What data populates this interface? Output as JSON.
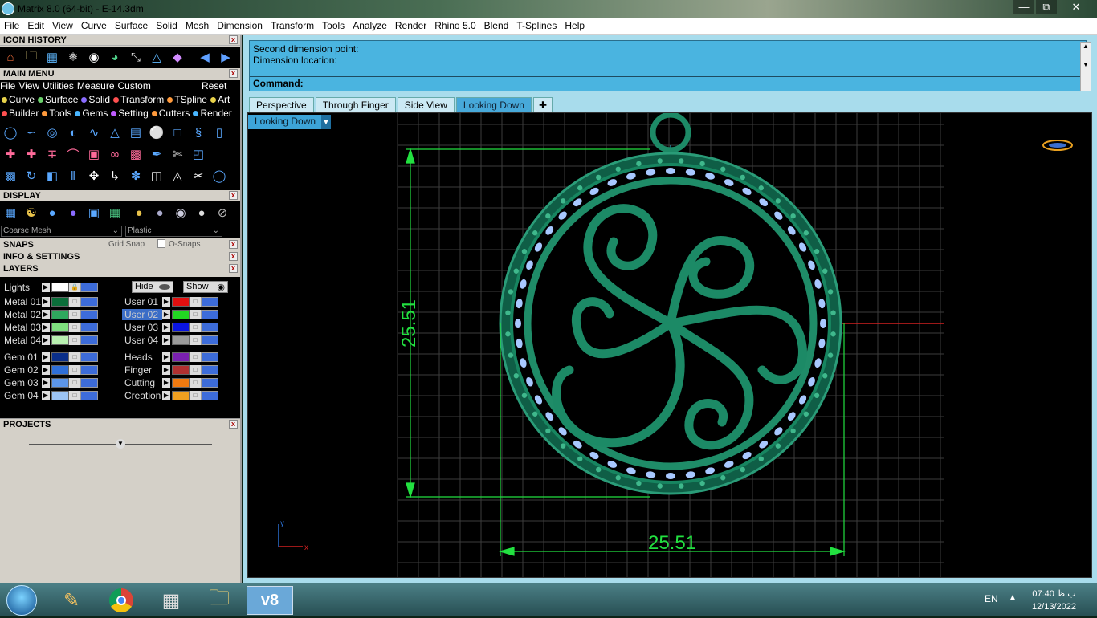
{
  "window": {
    "title": "Matrix 8.0 (64-bit) - E-14.3dm"
  },
  "menubar": [
    "File",
    "Edit",
    "View",
    "Curve",
    "Surface",
    "Solid",
    "Mesh",
    "Dimension",
    "Transform",
    "Tools",
    "Analyze",
    "Render",
    "Rhino 5.0",
    "Blend",
    "T-Splines",
    "Help"
  ],
  "sections": {
    "icon_history": "ICON HISTORY",
    "main_menu": "MAIN MENU",
    "display": "DISPLAY",
    "snaps": "SNAPS",
    "info": "INFO & SETTINGS",
    "layers": "LAYERS",
    "projects": "PROJECTS"
  },
  "main_menu": {
    "top": [
      "File",
      "View",
      "Utilities",
      "Measure",
      "Custom"
    ],
    "reset": "Reset",
    "row1": [
      {
        "label": "Curve",
        "color": "#e8d24a"
      },
      {
        "label": "Surface",
        "color": "#6bd06b"
      },
      {
        "label": "Solid",
        "color": "#8a6cff"
      },
      {
        "label": "Transform",
        "color": "#ff5050"
      },
      {
        "label": "TSpline",
        "color": "#ff9a3c"
      },
      {
        "label": "Art",
        "color": "#e8d24a"
      }
    ],
    "row2": [
      {
        "label": "Builder",
        "color": "#ff5050"
      },
      {
        "label": "Tools",
        "color": "#ff9a3c"
      },
      {
        "label": "Gems",
        "color": "#49b6ff"
      },
      {
        "label": "Setting",
        "color": "#c05cff"
      },
      {
        "label": "Cutters",
        "color": "#ff9a3c"
      },
      {
        "label": "Render",
        "color": "#49b6ff"
      }
    ]
  },
  "display": {
    "mesh_option": "Coarse Mesh",
    "material_option": "Plastic"
  },
  "snaps": {
    "grid_snap": "Grid Snap",
    "osnaps": "O-Snaps"
  },
  "layers": {
    "lights": "Lights",
    "hide": "Hide",
    "show": "Show",
    "left": [
      {
        "name": "Metal 01",
        "color": "#0b6e3a"
      },
      {
        "name": "Metal 02",
        "color": "#2fa85e"
      },
      {
        "name": "Metal 03",
        "color": "#7ee07e"
      },
      {
        "name": "Metal 04",
        "color": "#b8f0b0"
      },
      {
        "name": "Gem 01",
        "color": "#0a2f8a"
      },
      {
        "name": "Gem 02",
        "color": "#2f6fd8"
      },
      {
        "name": "Gem 03",
        "color": "#5c95e8"
      },
      {
        "name": "Gem 04",
        "color": "#9cc4f4"
      }
    ],
    "right": [
      {
        "name": "User 01",
        "color": "#e01010"
      },
      {
        "name": "User 02",
        "color": "#22d822",
        "selected": true
      },
      {
        "name": "User 03",
        "color": "#0a14e0"
      },
      {
        "name": "User 04",
        "color": "#9a9a9a"
      },
      {
        "name": "Heads",
        "color": "#7a20b0"
      },
      {
        "name": "Finger",
        "color": "#b03030"
      },
      {
        "name": "Cutting",
        "color": "#f07a10"
      },
      {
        "name": "Creation",
        "color": "#f0a020"
      }
    ]
  },
  "command": {
    "line1": "Second dimension point:",
    "line2": "Dimension location:",
    "prompt": "Command:"
  },
  "viewport_tabs": [
    "Perspective",
    "Through Finger",
    "Side View",
    "Looking Down"
  ],
  "active_tab": "Looking Down",
  "viewport": {
    "label": "Looking Down",
    "dim_vertical": "25.51",
    "dim_horizontal": "25.51",
    "axis_y": "y",
    "axis_x": "x"
  },
  "colors": {
    "model": "#1a7a5a",
    "dimension": "#22e040",
    "gems": "#a8c8ff"
  },
  "taskbar": {
    "lang": "EN",
    "time": "07:40 ب.ظ",
    "date": "12/13/2022"
  }
}
